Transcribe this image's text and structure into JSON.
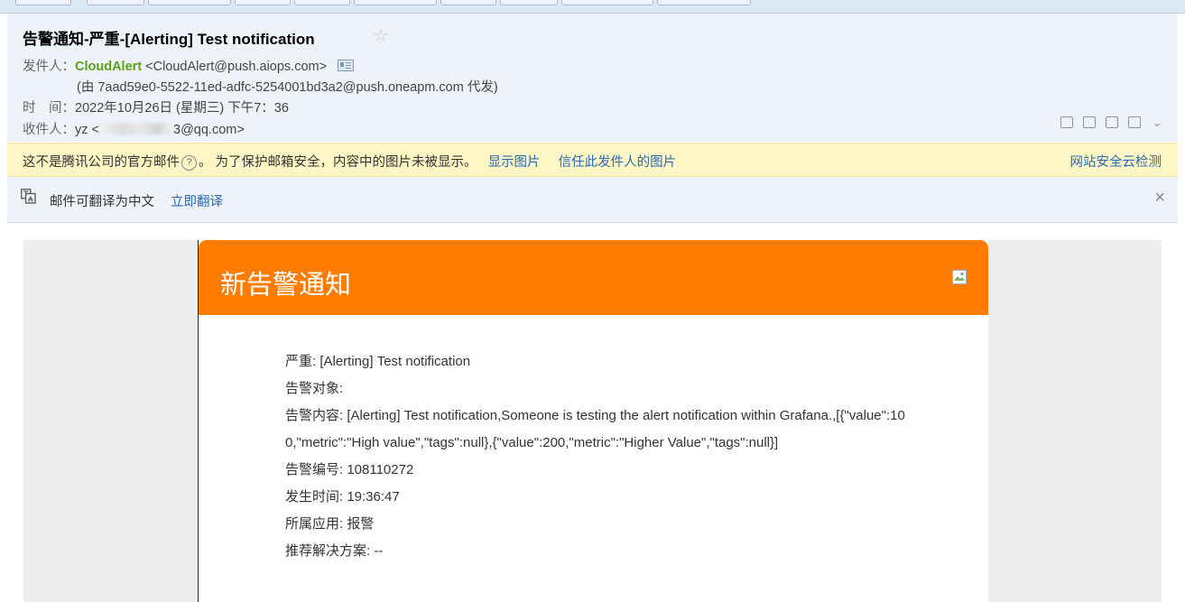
{
  "email": {
    "subject": "告警通知-严重-[Alerting] Test notification",
    "from_label": "发件人：",
    "from_name": "CloudAlert",
    "from_address": "<CloudAlert@push.aiops.com>",
    "via_line": "(由 7aad59e0-5522-11ed-adfc-5254001bd3a2@push.oneapm.com 代发)",
    "time_label": "时　间：",
    "time_value": "2022年10月26日 (星期三) 下午7：36",
    "to_label": "收件人：",
    "to_name": "yz",
    "to_address_prefix": "<",
    "to_address_suffix": "3@qq.com>"
  },
  "warning": {
    "text_a": "这不是腾讯公司的官方邮件",
    "help_icon": "?",
    "text_b": "。 为了保护邮箱安全，内容中的图片未被显示。",
    "show_images": "显示图片",
    "trust_sender": "信任此发件人的图片",
    "security_check": "网站安全云检测"
  },
  "translate": {
    "text": "邮件可翻译为中文",
    "action": "立即翻译",
    "close": "×"
  },
  "card": {
    "title": "新告警通知",
    "lines": [
      "严重: [Alerting] Test notification",
      "告警对象:",
      "告警内容: [Alerting] Test notification,Someone is testing the alert notification within Grafana.,[{\"value\":100,\"metric\":\"High value\",\"tags\":null},{\"value\":200,\"metric\":\"Higher Value\",\"tags\":null}]",
      "告警编号: 108110272",
      "发生时间: 19:36:47",
      "所属应用: 报警",
      "推荐解决方案: --"
    ]
  },
  "icons": {
    "star": "star-icon",
    "contact_card": "contact-card-icon",
    "translate": "translate-icon",
    "broken_image": "broken-image-icon"
  },
  "colors": {
    "card_header": "#ff7c00",
    "sender": "#5aa020",
    "link": "#2a6ab0",
    "warning_bg": "#fff6c6"
  }
}
